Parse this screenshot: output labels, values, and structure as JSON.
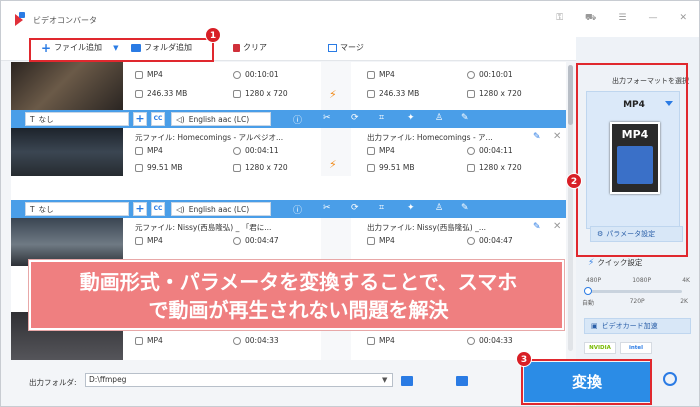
{
  "app": {
    "title": "ビデオコンバータ"
  },
  "toolbar": {
    "add_file": "ファイル追加",
    "add_folder": "フォルダ追加",
    "clear": "クリア",
    "merge": "マージ"
  },
  "files": [
    {
      "src_name": "",
      "dst_name": "",
      "src_format": "MP4",
      "src_duration": "00:10:01",
      "src_size": "246.33 MB",
      "src_resolution": "1280 x 720",
      "dst_format": "MP4",
      "dst_duration": "00:10:01",
      "dst_size": "246.33 MB",
      "dst_resolution": "1280 x 720",
      "subtitle": "なし",
      "audio": "English aac (LC)"
    },
    {
      "src_name": "元ファイル: Homecomings - アルペジオ...",
      "dst_name": "出力ファイル: Homecomings - ア...",
      "src_format": "MP4",
      "src_duration": "00:04:11",
      "src_size": "99.51 MB",
      "src_resolution": "1280 x 720",
      "dst_format": "MP4",
      "dst_duration": "00:04:11",
      "dst_size": "99.51 MB",
      "dst_resolution": "1280 x 720",
      "subtitle": "なし",
      "audio": "English aac (LC)"
    },
    {
      "src_name": "元ファイル: Nissy(西島隆弘) _ 「君に...",
      "dst_name": "出力ファイル: Nissy(西島隆弘) _...",
      "src_format": "MP4",
      "src_duration": "00:04:47",
      "dst_format": "MP4",
      "dst_duration": "00:04:47"
    },
    {
      "src_format": "MP4",
      "src_duration": "00:04:33",
      "dst_format": "MP4",
      "dst_duration": "00:04:33"
    }
  ],
  "overlay": {
    "line1": "動画形式・パラメータを変換することで、スマホ",
    "line2": "で動画が再生されない問題を解決"
  },
  "bottom": {
    "output_folder_label": "出力フォルダ:",
    "output_folder_value": "D:\\ffmpeg"
  },
  "right": {
    "select_format_label": "出力フォーマットを選択",
    "format_name": "MP4",
    "format_icon_text": "MP4",
    "param_button": "パラメータ設定",
    "quick_label": "クイック設定",
    "quick_top": [
      "480P",
      "1080P",
      "4K"
    ],
    "quick_bottom": [
      "自動",
      "720P",
      "2K"
    ],
    "gpu_button": "ビデオカード加速",
    "chips": [
      "NVIDIA",
      "intel"
    ]
  },
  "convert_button": "変換",
  "badges": [
    "1",
    "2",
    "3"
  ],
  "colors": {
    "accent": "#2b8ce6",
    "highlight": "#e0282e",
    "overlay": "#ef7f80"
  }
}
